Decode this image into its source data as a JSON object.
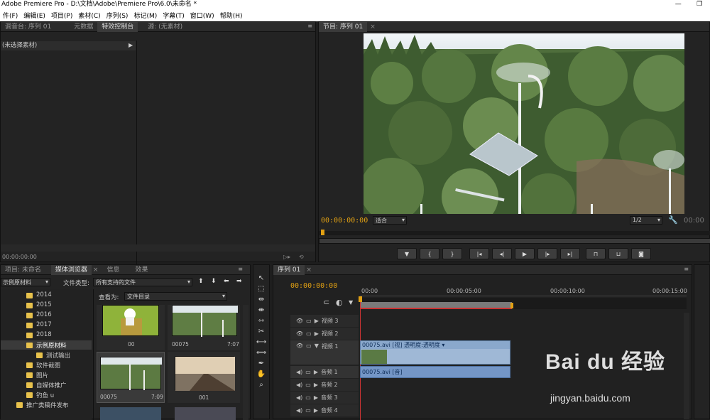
{
  "window": {
    "title": "Adobe Premiere Pro - D:\\文档\\Adobe\\Premiere Pro\\6.0\\未命名 *",
    "minimize": "—",
    "maximize": "❐"
  },
  "menu": [
    {
      "label": "件(F)"
    },
    {
      "label": "编辑(E)"
    },
    {
      "label": "项目(P)"
    },
    {
      "label": "素材(C)"
    },
    {
      "label": "序列(S)"
    },
    {
      "label": "标记(M)"
    },
    {
      "label": "字幕(T)"
    },
    {
      "label": "窗口(W)"
    },
    {
      "label": "帮助(H)"
    }
  ],
  "source_panel": {
    "tabs": [
      {
        "label": "调音台: 序列 01"
      },
      {
        "label": "元数据"
      },
      {
        "label": "特效控制台"
      },
      {
        "label": "源: (无素材)"
      }
    ],
    "header": "(未选择素材)",
    "timecode": "00:00:00:00"
  },
  "program_panel": {
    "tab": "节目: 序列 01",
    "timecode": "00:00:00:00",
    "fit": "适合",
    "quality": "1/2",
    "end_timecode": "00:00"
  },
  "project_panel": {
    "tabs": [
      {
        "label": "项目: 未命名"
      },
      {
        "label": "媒体浏览器"
      },
      {
        "label": "信息"
      },
      {
        "label": "效果"
      }
    ],
    "location": "示例原材料",
    "file_type_label": "文件类型:",
    "file_type_value": "所有支持的文件",
    "view_as_label": "查看为:",
    "view_as_value": "文件目录",
    "tree": [
      {
        "label": "2014"
      },
      {
        "label": "2015"
      },
      {
        "label": "2016"
      },
      {
        "label": "2017"
      },
      {
        "label": "2018"
      },
      {
        "label": "示例原材料"
      },
      {
        "label": "测试输出"
      },
      {
        "label": "软件截图"
      },
      {
        "label": "图片"
      },
      {
        "label": "自媒体推广"
      },
      {
        "label": "钓鱼 u"
      },
      {
        "label": "推广类稿件发布"
      }
    ],
    "thumbs": [
      {
        "name": "00",
        "duration": ""
      },
      {
        "name": "00075",
        "duration": "7:07"
      },
      {
        "name": "00075",
        "duration": "7:09"
      },
      {
        "name": "001",
        "duration": ""
      }
    ]
  },
  "timeline": {
    "tab": "序列 01",
    "timecode": "00:00:00:00",
    "ruler": [
      "00:00",
      "00:00:05:00",
      "00:00:10:00",
      "00:00:15:00"
    ],
    "tracks": [
      {
        "label": "视频 3"
      },
      {
        "label": "视频 2"
      },
      {
        "label": "视频 1"
      },
      {
        "label": "音频 1"
      },
      {
        "label": "音频 2"
      },
      {
        "label": "音频 3"
      },
      {
        "label": "音频 4"
      }
    ],
    "video_clip": "00075.avi [视] 透明度:透明度 ▾",
    "audio_clip": "00075.avi [音]"
  },
  "watermark": {
    "logo": "Bai du 经验",
    "url": "jingyan.baidu.com"
  }
}
